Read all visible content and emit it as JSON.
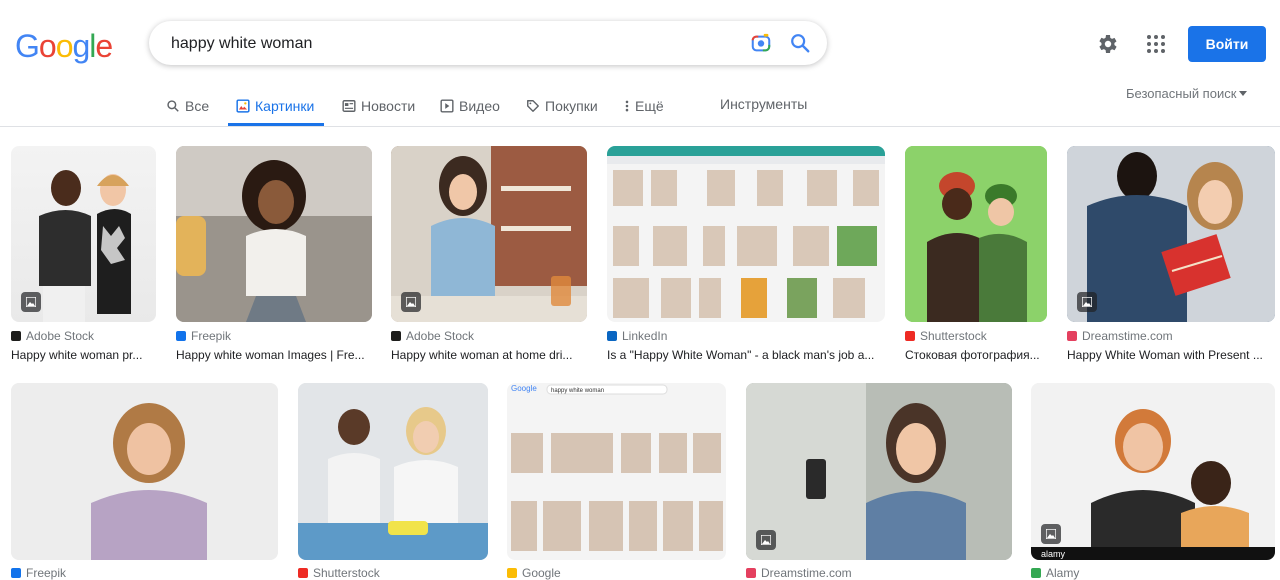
{
  "logo": {
    "letters": [
      "G",
      "o",
      "o",
      "g",
      "l",
      "e"
    ],
    "colors": [
      "#4285f4",
      "#ea4335",
      "#fbbc05",
      "#4285f4",
      "#34a853",
      "#ea4335"
    ]
  },
  "search": {
    "query": "happy white woman"
  },
  "header": {
    "signin_label": "Войти"
  },
  "tabs": [
    {
      "label": "Все",
      "icon": "search-icon"
    },
    {
      "label": "Картинки",
      "icon": "image-icon",
      "active": true
    },
    {
      "label": "Новости",
      "icon": "news-icon"
    },
    {
      "label": "Видео",
      "icon": "video-icon"
    },
    {
      "label": "Покупки",
      "icon": "tag-icon"
    },
    {
      "label": "Ещё",
      "icon": "more-vert-icon"
    }
  ],
  "tools_label": "Инструменты",
  "safe_search_label": "Безопасный поиск",
  "results_row1": [
    {
      "source": "Adobe Stock",
      "caption": "Happy white woman pr...",
      "fav_color": "#1d1d1b"
    },
    {
      "source": "Freepik",
      "caption": "Happy white woman Images | Fre...",
      "fav_color": "#1273eb"
    },
    {
      "source": "Adobe Stock",
      "caption": "Happy white woman at home dri...",
      "fav_color": "#1d1d1b"
    },
    {
      "source": "LinkedIn",
      "caption": "Is a \"Happy White Woman\" - a black man's job a...",
      "fav_color": "#0a66c2"
    },
    {
      "source": "Shutterstock",
      "caption": "Стоковая фотография...",
      "fav_color": "#ee2b24"
    },
    {
      "source": "Dreamstime.com",
      "caption": "Happy White Woman with Present ...",
      "fav_color": "#e4405f"
    }
  ],
  "results_row2": [
    {
      "source": "Freepik",
      "fav_color": "#1273eb"
    },
    {
      "source": "Shutterstock",
      "fav_color": "#ee2b24"
    },
    {
      "source": "Google",
      "fav_color": "#fbbc05"
    },
    {
      "source": "Dreamstime.com",
      "fav_color": "#e4405f"
    },
    {
      "source": "Alamy",
      "fav_color": "#34a853"
    }
  ],
  "thumb_text": {
    "google_mini": "Google",
    "google_mini_query": "happy white woman",
    "alamy": "alamy"
  }
}
